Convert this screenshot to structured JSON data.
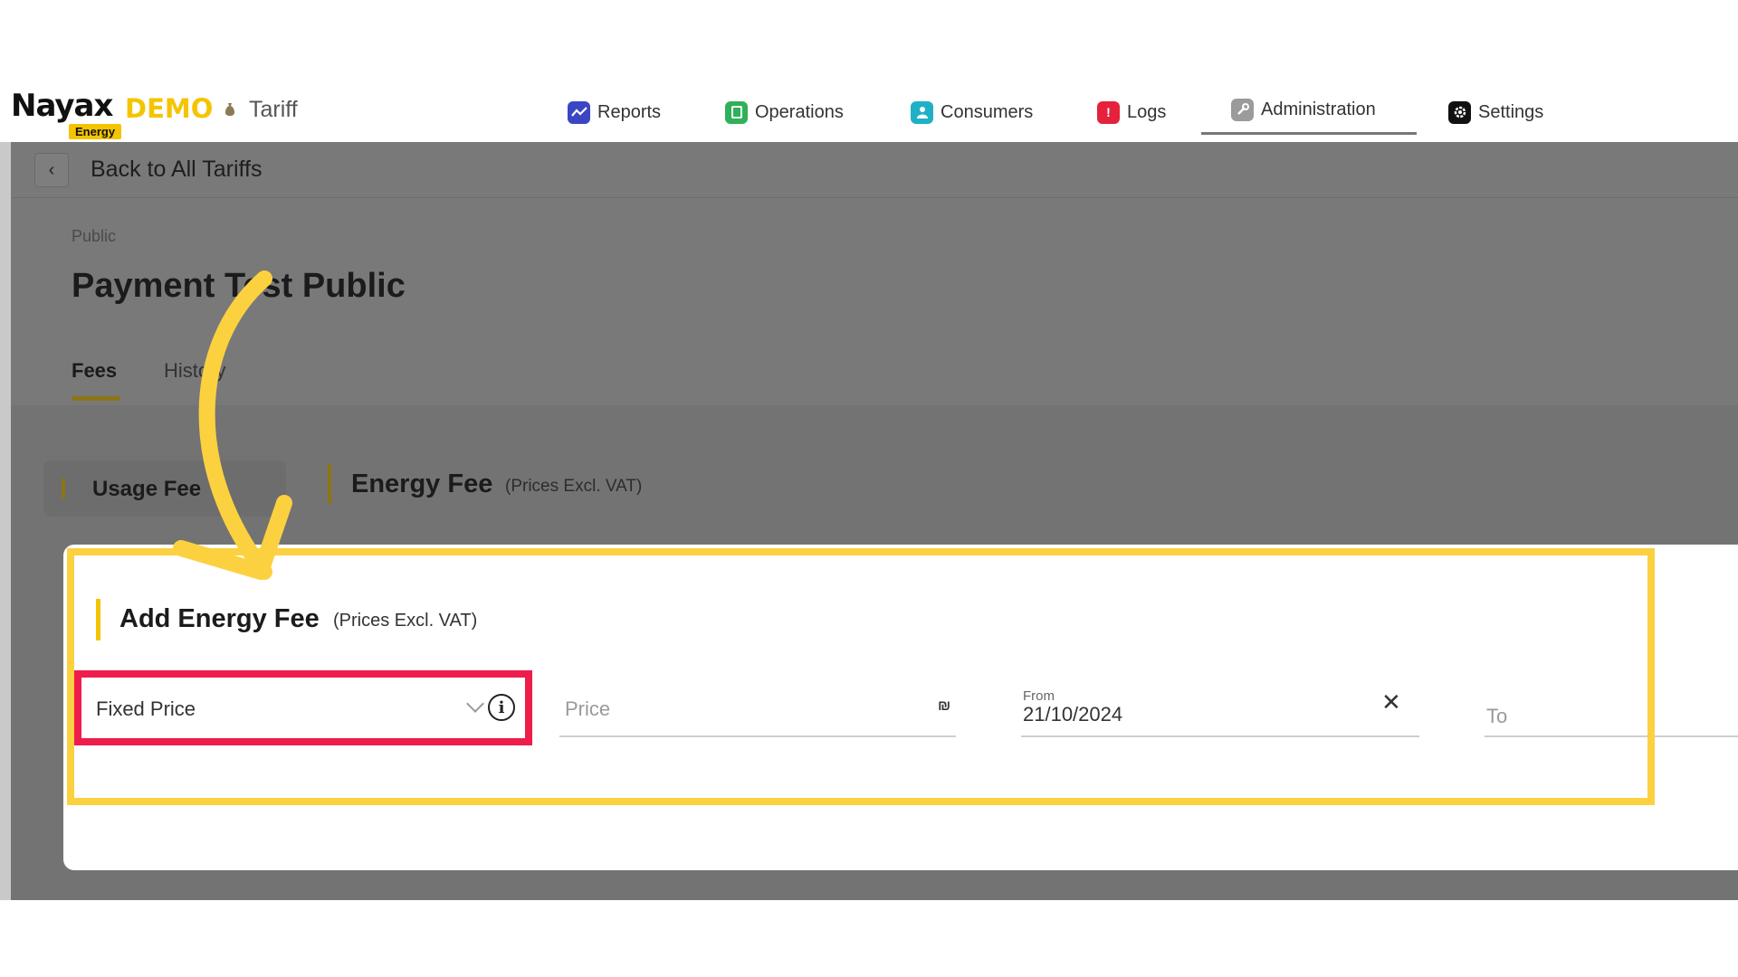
{
  "brand": {
    "logo": "Nayax",
    "demo": "DEMO",
    "energy": "Energy",
    "section": "Tariff"
  },
  "nav": {
    "items": [
      {
        "label": "Reports",
        "icon": "reports-icon",
        "color": "#3b46c4"
      },
      {
        "label": "Operations",
        "icon": "operations-icon",
        "color": "#2fb05a"
      },
      {
        "label": "Consumers",
        "icon": "consumers-icon",
        "color": "#1fb0c7"
      },
      {
        "label": "Logs",
        "icon": "logs-icon",
        "color": "#e5213b"
      },
      {
        "label": "Administration",
        "icon": "administration-icon",
        "color": "#9b9b9b"
      },
      {
        "label": "Settings",
        "icon": "settings-icon",
        "color": "#111111"
      }
    ],
    "active": "Administration"
  },
  "back": {
    "label": "Back to All Tariffs"
  },
  "tariff": {
    "visibility": "Public",
    "title": "Payment Test Public"
  },
  "tabs": [
    {
      "label": "Fees",
      "active": true
    },
    {
      "label": "History",
      "active": false
    }
  ],
  "fee_types": {
    "usage_label": "Usage Fee"
  },
  "section": {
    "title": "Energy Fee",
    "note": "(Prices Excl. VAT)"
  },
  "modal": {
    "title": "Add Energy Fee",
    "note": "(Prices Excl. VAT)",
    "type_select": {
      "value": "Fixed Price"
    },
    "price": {
      "placeholder": "Price",
      "currency": "₪"
    },
    "from": {
      "label": "From",
      "value": "21/10/2024"
    },
    "to": {
      "placeholder": "To"
    }
  },
  "colors": {
    "accent": "#f5c400",
    "highlight_yellow": "#fcd140",
    "highlight_red": "#ee1d4c",
    "overlay": "#797979"
  }
}
